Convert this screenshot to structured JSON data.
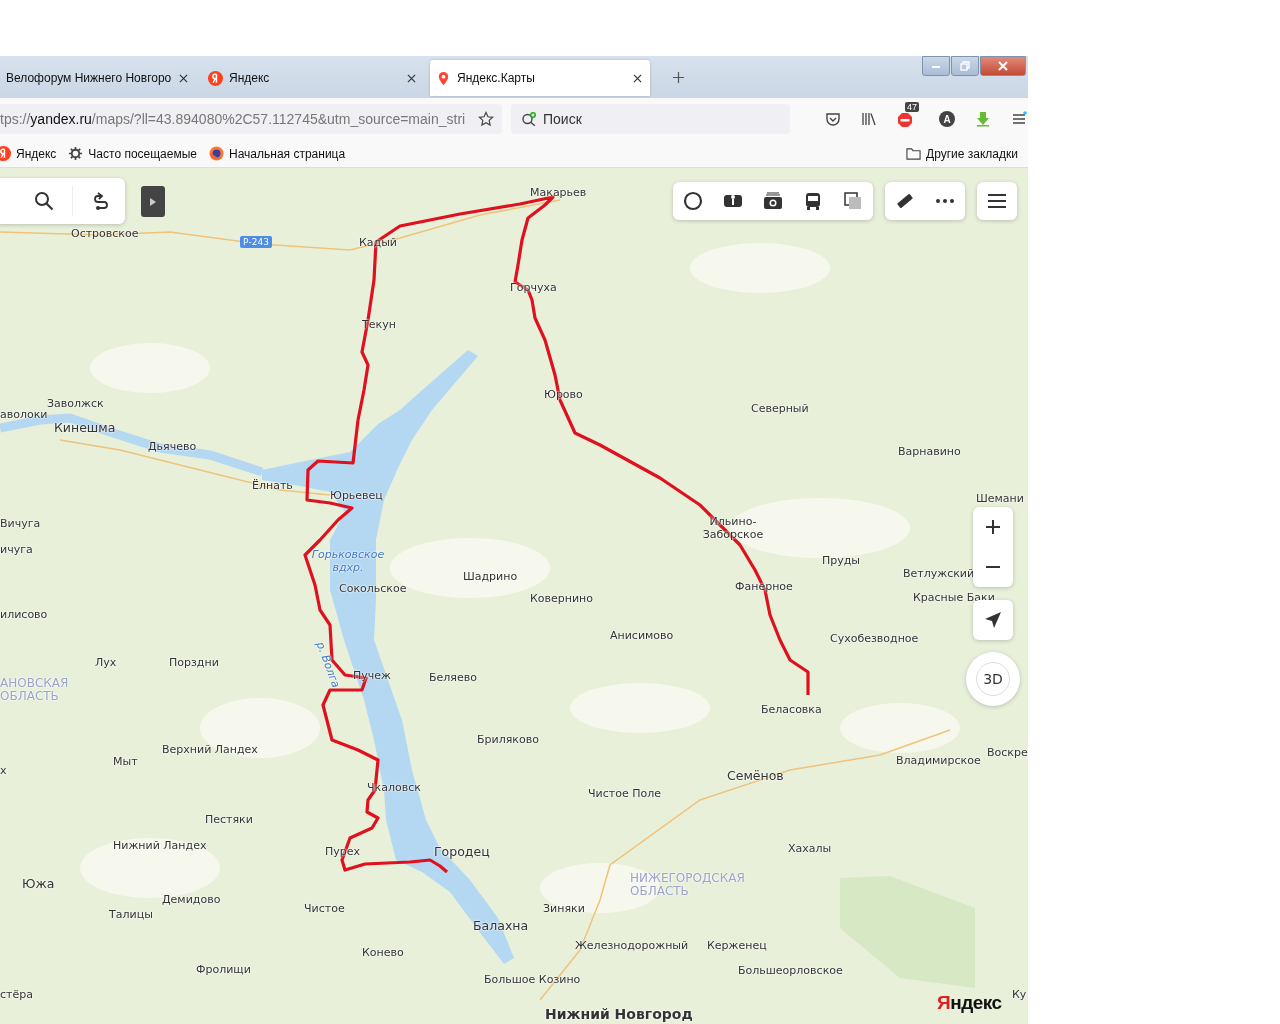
{
  "tabs": [
    {
      "title": "Велофорум Нижнего Новгоро",
      "kind": "plain",
      "selected": false
    },
    {
      "title": "Яндекс",
      "kind": "yandex",
      "selected": false
    },
    {
      "title": "Яндекс.Карты",
      "kind": "maps",
      "selected": true
    }
  ],
  "address_bar": {
    "scheme": "tps://",
    "host": "yandex.ru",
    "path": "/maps/?ll=43.894080%2C57.112745&utm_source=main_stri"
  },
  "search": {
    "placeholder": "Поиск"
  },
  "toolbar": {
    "adblock_badge": "47",
    "account_initial": "A"
  },
  "bookmarks": [
    {
      "label": "Яндекс",
      "kind": "yandex"
    },
    {
      "label": "Часто посещаемые",
      "kind": "gear"
    },
    {
      "label": "Начальная страница",
      "kind": "firefox"
    }
  ],
  "other_bookmarks": "Другие закладки",
  "map": {
    "road_badge": "Р-243",
    "three_d": "3D",
    "logo": "Яндекс",
    "labels": [
      {
        "text": "Макарьев",
        "kind": "town"
      },
      {
        "text": "Островское",
        "kind": "town"
      },
      {
        "text": "Кадый",
        "kind": "town"
      },
      {
        "text": "Горчуха",
        "kind": "town"
      },
      {
        "text": "Текун",
        "kind": "town"
      },
      {
        "text": "Юрово",
        "kind": "town"
      },
      {
        "text": "Заволжск",
        "kind": "town"
      },
      {
        "text": "аволоки",
        "kind": "town"
      },
      {
        "text": "Северный",
        "kind": "town"
      },
      {
        "text": "Кинешма",
        "kind": "city"
      },
      {
        "text": "Дьячево",
        "kind": "town"
      },
      {
        "text": "Варнавино",
        "kind": "town"
      },
      {
        "text": "Ёлнать",
        "kind": "town"
      },
      {
        "text": "Юрьевец",
        "kind": "town"
      },
      {
        "text": "Шемани",
        "kind": "town"
      },
      {
        "text": "Вичуга",
        "kind": "town"
      },
      {
        "text": "Ильино-Заборское",
        "kind": "town"
      },
      {
        "text": "ичуга",
        "kind": "town"
      },
      {
        "text": "Горьковское вдхр.",
        "kind": "water"
      },
      {
        "text": "Пруды",
        "kind": "town"
      },
      {
        "text": "Шадрино",
        "kind": "town"
      },
      {
        "text": "Ветлужский",
        "kind": "town"
      },
      {
        "text": "Сокольское",
        "kind": "town"
      },
      {
        "text": "Фанерное",
        "kind": "town"
      },
      {
        "text": "Ковернино",
        "kind": "town"
      },
      {
        "text": "Красные Баки",
        "kind": "town"
      },
      {
        "text": "илисово",
        "kind": "town"
      },
      {
        "text": "р. Волга",
        "kind": "river"
      },
      {
        "text": "Анисимово",
        "kind": "town"
      },
      {
        "text": "Сухобезводное",
        "kind": "town"
      },
      {
        "text": "Лух",
        "kind": "town"
      },
      {
        "text": "Порздни",
        "kind": "town"
      },
      {
        "text": "Пучеж",
        "kind": "town"
      },
      {
        "text": "Беляево",
        "kind": "town"
      },
      {
        "text": "АНОВСКАЯ ОБЛАСТЬ",
        "kind": "region"
      },
      {
        "text": "Беласовка",
        "kind": "town"
      },
      {
        "text": "Бриляково",
        "kind": "town"
      },
      {
        "text": "Верхний Ландех",
        "kind": "town"
      },
      {
        "text": "Мыт",
        "kind": "town"
      },
      {
        "text": "Владимирское",
        "kind": "town"
      },
      {
        "text": "Воскре",
        "kind": "town"
      },
      {
        "text": "х",
        "kind": "town"
      },
      {
        "text": "Семёнов",
        "kind": "city"
      },
      {
        "text": "Чкаловск",
        "kind": "town"
      },
      {
        "text": "Чистое Поле",
        "kind": "town"
      },
      {
        "text": "Пестяки",
        "kind": "town"
      },
      {
        "text": "Нижний Ландех",
        "kind": "town"
      },
      {
        "text": "Пурех",
        "kind": "town"
      },
      {
        "text": "Городец",
        "kind": "city"
      },
      {
        "text": "Хахалы",
        "kind": "town"
      },
      {
        "text": "Южа",
        "kind": "city"
      },
      {
        "text": "НИЖЕГОРОДСКАЯ ОБЛАСТЬ",
        "kind": "region"
      },
      {
        "text": "Демидово",
        "kind": "town"
      },
      {
        "text": "Талицы",
        "kind": "town"
      },
      {
        "text": "Чистое",
        "kind": "town"
      },
      {
        "text": "Зиняки",
        "kind": "town"
      },
      {
        "text": "Балахна",
        "kind": "city"
      },
      {
        "text": "Конево",
        "kind": "town"
      },
      {
        "text": "Железнодорожный",
        "kind": "town"
      },
      {
        "text": "Керженец",
        "kind": "town"
      },
      {
        "text": "Фролищи",
        "kind": "town"
      },
      {
        "text": "Большое Козино",
        "kind": "town"
      },
      {
        "text": "Большеорловское",
        "kind": "town"
      },
      {
        "text": "стёра",
        "kind": "town"
      },
      {
        "text": "Ку",
        "kind": "town"
      },
      {
        "text": "Нижний Новгород",
        "kind": "capital"
      }
    ]
  }
}
